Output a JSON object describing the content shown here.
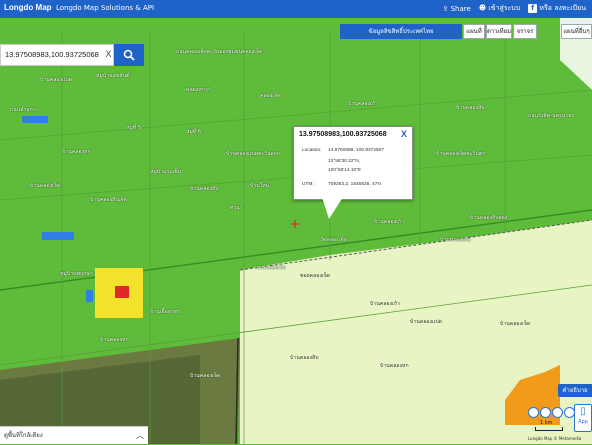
{
  "topbar": {
    "logo": "Longdo Map",
    "subtitle": "Longdo Map Solutions & API",
    "share": "Share",
    "signin": "เข้าสู่ระบบ",
    "register": "หรือ ลงทะเบียน"
  },
  "search": {
    "value": "13.97508983,100.93725068",
    "clear": "X"
  },
  "toolbar": {
    "layer": "ข้อมูลลิขสิทธิ์ประเทศไทย",
    "btn1": "แผนที่",
    "btn2": "ดาวเทียม",
    "btn3": "จราจร",
    "btn4": "แผนที่อื่นๆ"
  },
  "popup": {
    "title": "13.97508983,100.93725068",
    "close": "X",
    "location_label": "Location:",
    "location_value": "13.9750898, 100.9372507",
    "dms_lat": "13°58'30.32\"N,",
    "dms_lon": "100°56'14.10\"E",
    "utm_label": "UTM:",
    "utm_value": "709263.2, 1545826, 47N"
  },
  "legend_button": "คำอธิบาย",
  "bottom_panel": "ดูพื้นที่ใกล้เคียง",
  "scale": "1 km",
  "credit": "Longdo Map © Metamedia",
  "app_badge": "App",
  "place_labels": [
    "ถนนคลองเจ็ดตะวันออก",
    "ชุมชนคลองเจ็ด",
    "หมู่บ้านสุขสันต์",
    "บ้านคลองแปด",
    "คลองหกวา",
    "คลองเจ็ด",
    "บ้านคลองเก้า",
    "บ้านคลองสิบ",
    "ถนนลำลูกกา",
    "หมู่ที่ 5",
    "หมู่ที่ 6",
    "บ้านคลองแปดตะวันออก",
    "บ้านคลองเจ็ดตะวันตก",
    "ถนนรังสิต-นครนายก",
    "บ้านคลองหก",
    "หมู่บ้านร่มเย็น",
    "บ้านใหม่",
    "บ้านคลองสิบ",
    "บ้านคลองเจ็ด",
    "บ้านคลองสิบเอ็ด",
    "ทุ่งนา",
    "บ้านคลองสิบสอง",
    "บ้านคลองเก้า",
    "วัดคลองเจ็ด",
    "ถนนคลองเจ็ด",
    "หมู่บ้านพฤกษา",
    "ซอยคลองเจ็ด",
    "บ้านหนองเสือ",
    "บ้านคลองเก้า",
    "บ้านคลองแปด",
    "บ้านคลองเจ็ด",
    "บ้านคลองสิบ",
    "บ้านคลองหก",
    "บ้านคลองหก",
    "บ้านเอื้ออาทร",
    "บ้านคลองเจ็ด"
  ]
}
